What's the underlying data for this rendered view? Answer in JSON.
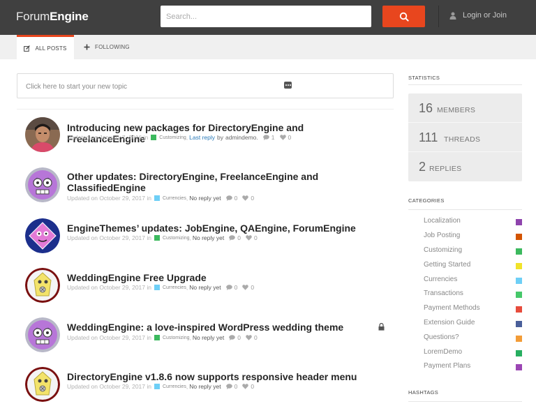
{
  "header": {
    "logo_light": "Forum",
    "logo_bold": "Engine",
    "search_placeholder": "Search...",
    "login_label": "Login or Join"
  },
  "tabs": [
    {
      "label": "ALL POSTS",
      "icon": "edit-icon",
      "active": true
    },
    {
      "label": "FOLLOWING",
      "icon": "plus-icon",
      "active": false
    }
  ],
  "composer": {
    "placeholder": "Click here to start your new topic"
  },
  "threads": [
    {
      "title": "Introducing new packages for DirectoryEngine and FreelanceEngine",
      "updated": "Updated on January 7, 2016 in",
      "category": "Customizing",
      "category_color": "#3cb95e",
      "reply": "Last reply",
      "by": "by",
      "author": "admindemo.",
      "comments": "1",
      "likes": "0",
      "avatar": "photo-avatar",
      "locked": false
    },
    {
      "title_line1": "Other updates: DirectoryEngine, FreelanceEngine and",
      "title_line2": "ClassifiedEngine",
      "updated": "Updated on October 29, 2017 in",
      "category": "Currencies",
      "category_color": "#6ecff6",
      "reply": "No reply yet",
      "comments": "0",
      "likes": "0",
      "avatar": "purple-face-avatar",
      "locked": false
    },
    {
      "title": "EngineThemes’ updates: JobEngine, QAEngine, ForumEngine",
      "updated": "Updated on October 29, 2017 in",
      "category": "Customizing",
      "category_color": "#3cb95e",
      "reply": "No reply yet",
      "comments": "0",
      "likes": "0",
      "avatar": "diamond-face-avatar",
      "locked": false
    },
    {
      "title": "WeddingEngine Free Upgrade",
      "updated": "Updated on October 29, 2017 in",
      "category": "Currencies",
      "category_color": "#6ecff6",
      "reply": "No reply yet",
      "comments": "0",
      "likes": "0",
      "avatar": "yellow-face-avatar",
      "locked": false
    },
    {
      "title": "WeddingEngine: a love-inspired WordPress wedding theme",
      "updated": "Updated on October 29, 2017 in",
      "category": "Customizing",
      "category_color": "#3cb95e",
      "reply": "No reply yet",
      "comments": "0",
      "likes": "0",
      "avatar": "purple-face-avatar",
      "locked": true
    },
    {
      "title": "DirectoryEngine v1.8.6 now supports responsive header menu",
      "updated": "Updated on October 29, 2017 in",
      "category": "Currencies",
      "category_color": "#6ecff6",
      "reply": "No reply yet",
      "comments": "0",
      "likes": "0",
      "avatar": "yellow-face-avatar",
      "locked": false
    }
  ],
  "sidebar": {
    "statistics_title": "STATISTICS",
    "stats": [
      {
        "num": "16",
        "label": "MEMBERS"
      },
      {
        "num": "111",
        "label": "THREADS"
      },
      {
        "num": "2",
        "label": "REPLIES"
      }
    ],
    "categories_title": "CATEGORIES",
    "categories": [
      {
        "label": "Localization",
        "color": "#8e44ad"
      },
      {
        "label": "Job Posting",
        "color": "#d35400"
      },
      {
        "label": "Customizing",
        "color": "#3cb95e"
      },
      {
        "label": "Getting Started",
        "color": "#f1e32a"
      },
      {
        "label": "Currencies",
        "color": "#6ecff6"
      },
      {
        "label": "Transactions",
        "color": "#46c86a"
      },
      {
        "label": "Payment Methods",
        "color": "#e74c3c"
      },
      {
        "label": "Extension Guide",
        "color": "#4a5f9a"
      },
      {
        "label": "Questions?",
        "color": "#f39c37"
      },
      {
        "label": "LoremDemo",
        "color": "#27ae60"
      },
      {
        "label": "Payment Plans",
        "color": "#9b46b4"
      }
    ],
    "hashtags_title": "HASHTAGS"
  }
}
